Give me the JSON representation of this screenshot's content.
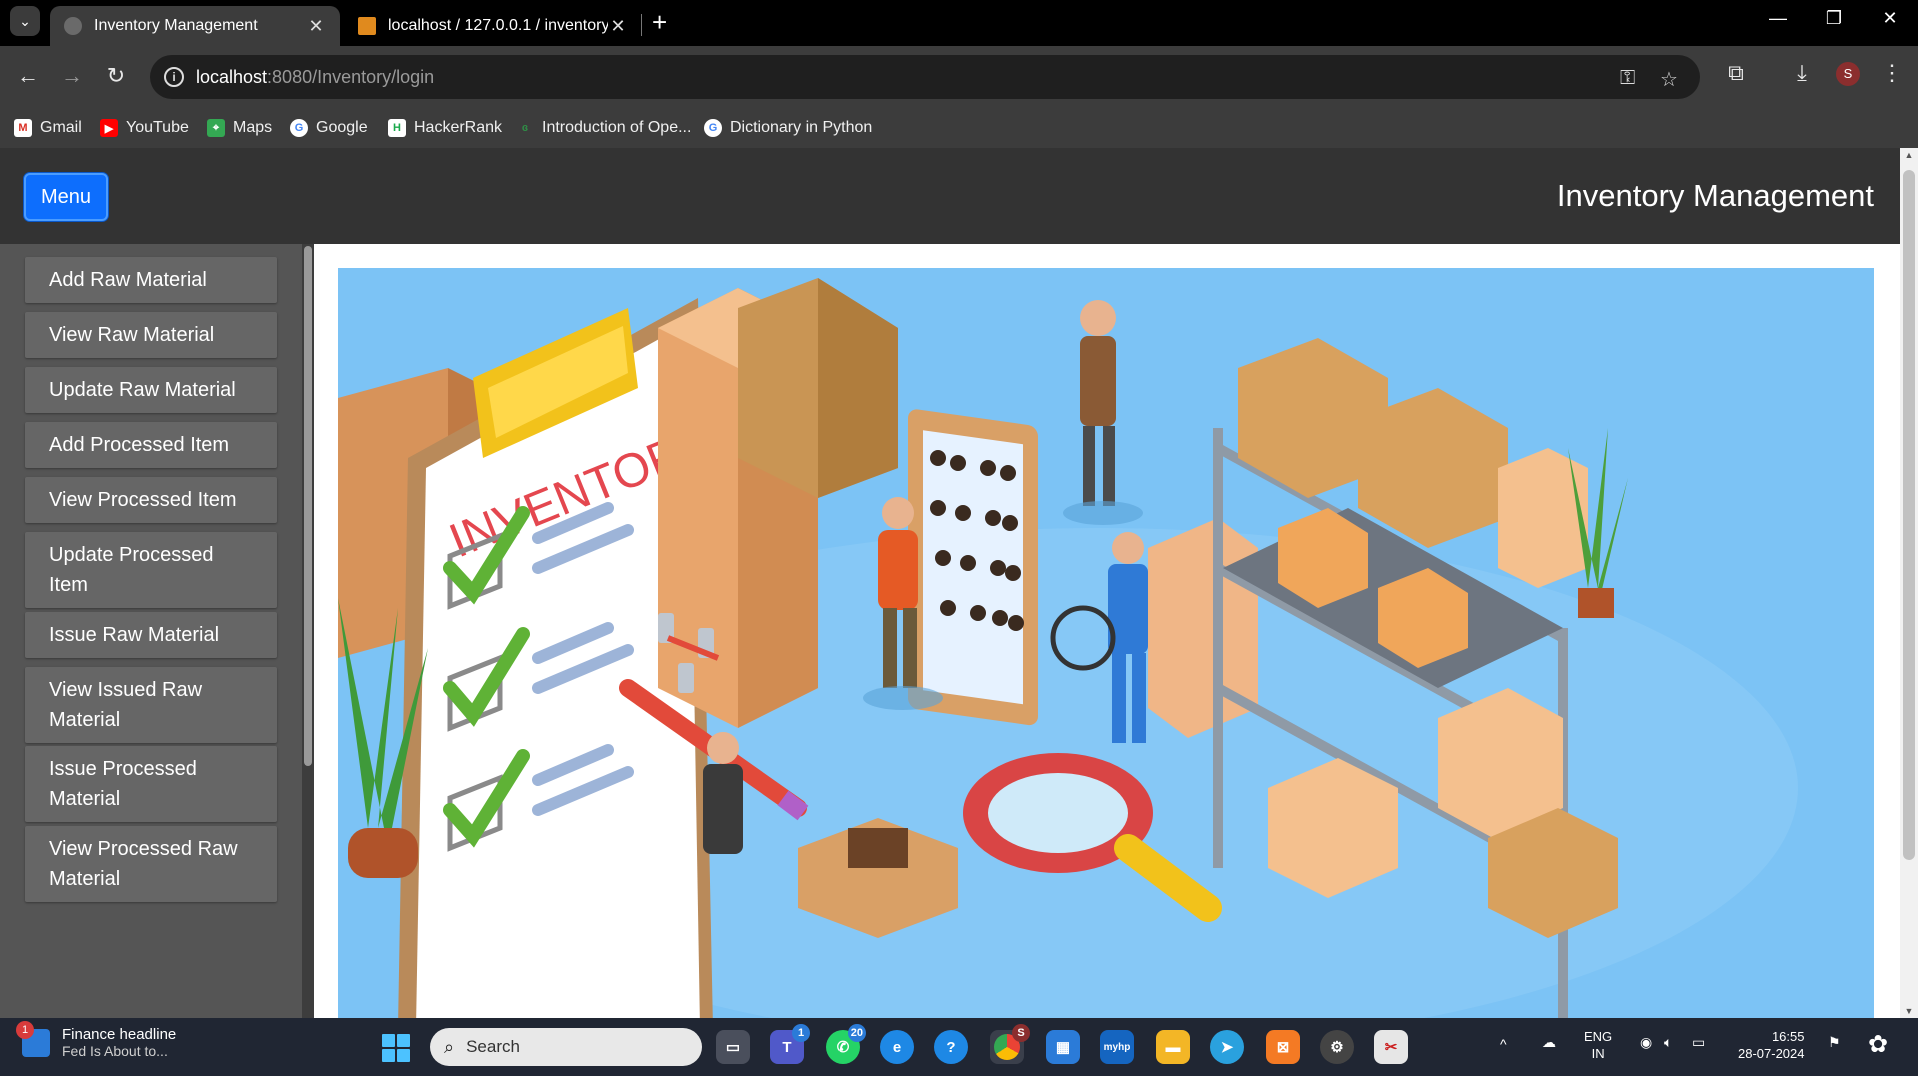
{
  "browser": {
    "tabs": [
      {
        "title": "Inventory Management",
        "active": true
      },
      {
        "title": "localhost / 127.0.0.1 / inventory",
        "active": false
      }
    ],
    "url_host": "localhost",
    "url_rest": ":8080/Inventory/login",
    "profile_initial": "S",
    "bookmarks": [
      "Gmail",
      "YouTube",
      "Maps",
      "Google",
      "HackerRank",
      "Introduction of Ope...",
      "Dictionary in Python"
    ]
  },
  "header": {
    "menu_label": "Menu",
    "title": "Inventory Management"
  },
  "sidebar": {
    "items": [
      "Add Raw Material",
      "View Raw Material",
      "Update Raw Material",
      "Add Processed Item",
      "View Processed Item",
      "Update Processed Item",
      "Issue Raw Material",
      "View Issued Raw Material",
      "Issue Processed Material",
      "View Processed Raw Material"
    ]
  },
  "hero": {
    "clipboard_text": "INVENTORY"
  },
  "taskbar": {
    "news_title": "Finance headline",
    "news_sub": "Fed Is About to...",
    "news_badge": "1",
    "search_placeholder": "Search",
    "teams_badge": "1",
    "whatsapp_badge": "20",
    "chrome_badge": "S",
    "lang_top": "ENG",
    "lang_bottom": "IN",
    "time": "16:55",
    "date": "28-07-2024"
  },
  "colors": {
    "menu_button": "#0d6efd",
    "header_bg": "#333333",
    "sidebar_bg": "#555555",
    "sidebar_item_bg": "#666666",
    "hero_bg": "#7cc3f5"
  }
}
